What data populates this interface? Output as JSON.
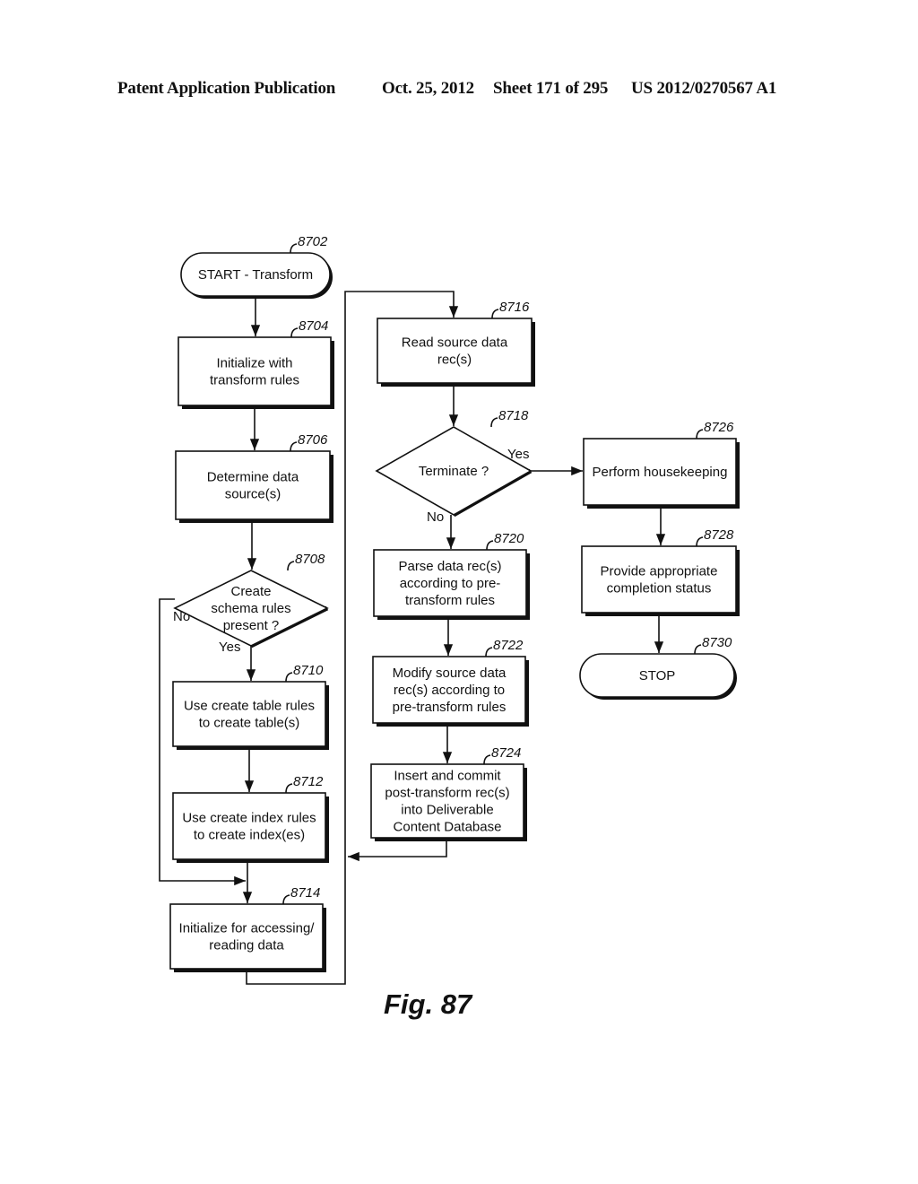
{
  "header": {
    "publication": "Patent Application Publication",
    "date": "Oct. 25, 2012",
    "sheet": "Sheet 171 of 295",
    "number": "US 2012/0270567 A1"
  },
  "figure_label": "Fig. 87",
  "nodes": {
    "n8702": {
      "ref": "8702",
      "type": "terminal",
      "lines": [
        "START - Transform"
      ]
    },
    "n8704": {
      "ref": "8704",
      "type": "process",
      "lines": [
        "Initialize with",
        "transform rules"
      ]
    },
    "n8706": {
      "ref": "8706",
      "type": "process",
      "lines": [
        "Determine data",
        "source(s)"
      ]
    },
    "n8708": {
      "ref": "8708",
      "type": "decision",
      "lines": [
        "Create",
        "schema rules",
        "present ?"
      ],
      "yes": "Yes",
      "no": "No"
    },
    "n8710": {
      "ref": "8710",
      "type": "process",
      "lines": [
        "Use create table rules",
        "to create table(s)"
      ]
    },
    "n8712": {
      "ref": "8712",
      "type": "process",
      "lines": [
        "Use create index rules",
        "to create index(es)"
      ]
    },
    "n8714": {
      "ref": "8714",
      "type": "process",
      "lines": [
        "Initialize for accessing/",
        "reading data"
      ]
    },
    "n8716": {
      "ref": "8716",
      "type": "process",
      "lines": [
        "Read source data",
        "rec(s)"
      ]
    },
    "n8718": {
      "ref": "8718",
      "type": "decision",
      "lines": [
        "Terminate ?"
      ],
      "yes": "Yes",
      "no": "No"
    },
    "n8720": {
      "ref": "8720",
      "type": "process",
      "lines": [
        "Parse data rec(s)",
        "according to pre-",
        "transform rules"
      ]
    },
    "n8722": {
      "ref": "8722",
      "type": "process",
      "lines": [
        "Modify source data",
        "rec(s) according to",
        "pre-transform rules"
      ]
    },
    "n8724": {
      "ref": "8724",
      "type": "process",
      "lines": [
        "Insert and commit",
        "post-transform rec(s)",
        "into Deliverable",
        "Content Database"
      ]
    },
    "n8726": {
      "ref": "8726",
      "type": "process",
      "lines": [
        "Perform housekeeping"
      ]
    },
    "n8728": {
      "ref": "8728",
      "type": "process",
      "lines": [
        "Provide appropriate",
        "completion status"
      ]
    },
    "n8730": {
      "ref": "8730",
      "type": "terminal",
      "lines": [
        "STOP"
      ]
    }
  },
  "edges": [
    {
      "from": "8702",
      "to": "8704"
    },
    {
      "from": "8704",
      "to": "8706"
    },
    {
      "from": "8706",
      "to": "8708"
    },
    {
      "from": "8708",
      "to": "8710",
      "label": "Yes"
    },
    {
      "from": "8708",
      "to": "8714",
      "label": "No"
    },
    {
      "from": "8710",
      "to": "8712"
    },
    {
      "from": "8712",
      "to": "8714"
    },
    {
      "from": "8714",
      "to": "8716"
    },
    {
      "from": "8716",
      "to": "8718"
    },
    {
      "from": "8718",
      "to": "8726",
      "label": "Yes"
    },
    {
      "from": "8718",
      "to": "8720",
      "label": "No"
    },
    {
      "from": "8720",
      "to": "8722"
    },
    {
      "from": "8722",
      "to": "8724"
    },
    {
      "from": "8724",
      "to": "8716"
    },
    {
      "from": "8726",
      "to": "8728"
    },
    {
      "from": "8728",
      "to": "8730"
    }
  ]
}
